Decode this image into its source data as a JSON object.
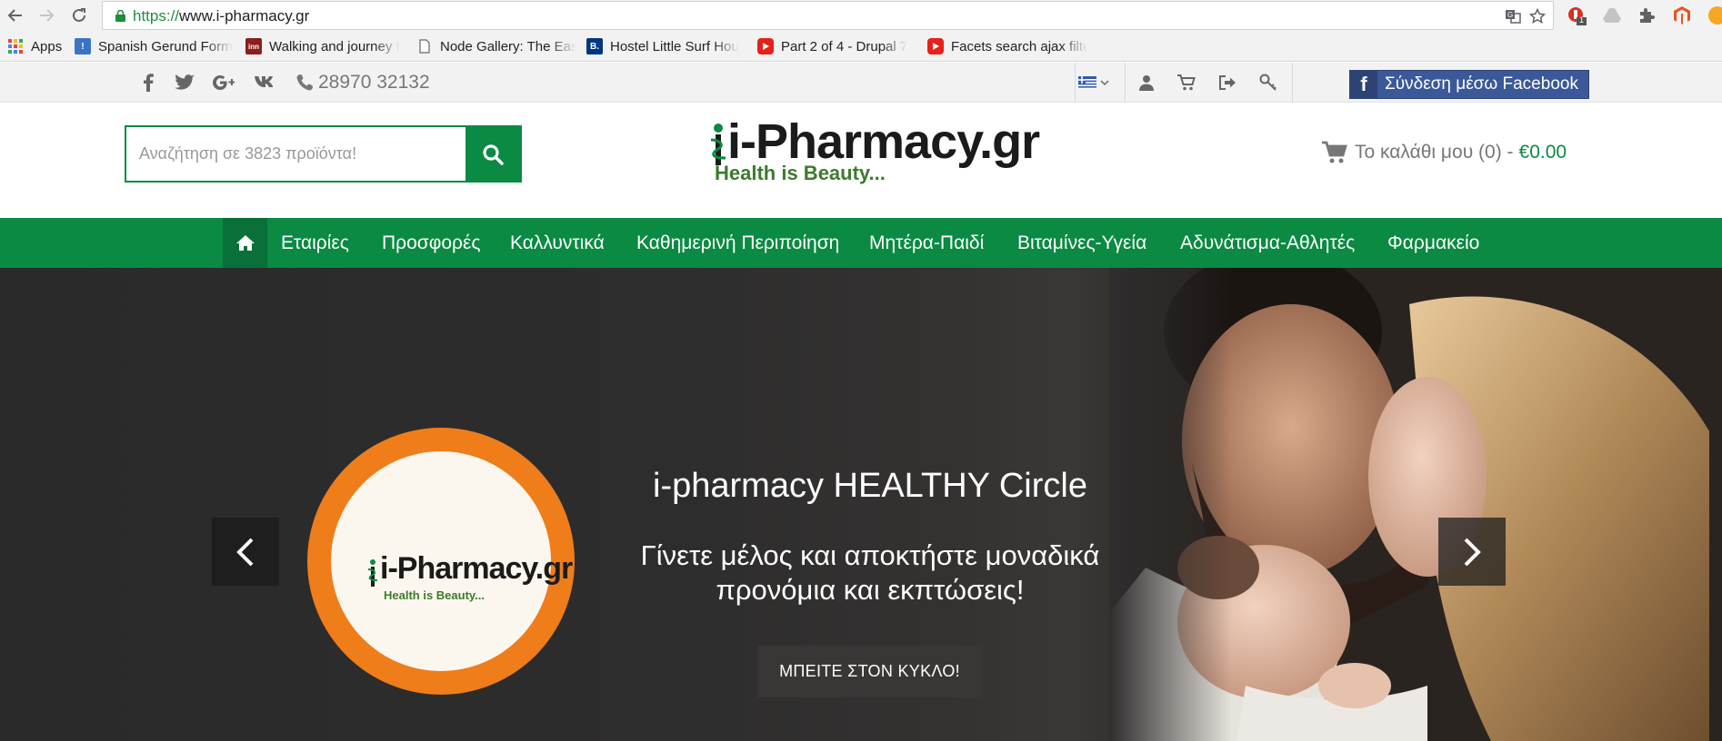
{
  "browser": {
    "url_scheme": "https://",
    "url_host": "www.i-pharmacy.gr",
    "extension_badge": "1",
    "bookmarks": [
      {
        "label": "Apps",
        "icon": "apps-grid-icon"
      },
      {
        "label": "Spanish Gerund Form",
        "icon": "bookmark-blue-icon"
      },
      {
        "label": "Walking and journey I",
        "icon": "bookmark-inn-icon"
      },
      {
        "label": "Node Gallery: The Eas",
        "icon": "page-icon"
      },
      {
        "label": "Hostel Little Surf Hou",
        "icon": "booking-icon"
      },
      {
        "label": "Part 2 of 4 - Drupal 7",
        "icon": "youtube-icon"
      },
      {
        "label": "Facets search ajax filte",
        "icon": "youtube-icon"
      }
    ]
  },
  "topbar": {
    "phone": "28970 32132",
    "facebook_login": "Σύνδεση μέσω Facebook",
    "facebook_letter": "f",
    "social_icons": [
      "facebook-icon",
      "twitter-icon",
      "google-plus-icon",
      "vk-icon"
    ]
  },
  "header": {
    "search_placeholder": "Αναζήτηση σε 3823 προϊόντα!",
    "logo_text": "i-Pharmacy.gr",
    "logo_tagline": "Health is Beauty...",
    "cart_label": "Το καλάθι μου (0) -",
    "cart_total": "€0.00"
  },
  "menu": {
    "items": [
      "Εταιρίες",
      "Προσφορές",
      "Καλλυντικά",
      "Καθημερινή Περιποίηση",
      "Μητέρα-Παιδί",
      "Βιταμίνες-Υγεία",
      "Αδυνάτισμα-Αθλητές",
      "Φαρμακείο"
    ]
  },
  "hero": {
    "badge_logo": "i-Pharmacy.gr",
    "badge_tagline": "Health is Beauty...",
    "title": "i-pharmacy HEALTHY Circle",
    "subtitle_line1": "Γίνετε μέλος και αποκτήστε μοναδικά",
    "subtitle_line2": "προνόμια και εκπτώσεις!",
    "cta": "ΜΠΕΙΤΕ ΣΤΟΝ ΚΥΚΛΟ!"
  },
  "colors": {
    "brand_green": "#0a8a43",
    "brand_green_dark": "#087038",
    "facebook_blue": "#3b5998",
    "badge_orange": "#ef7d1a"
  }
}
